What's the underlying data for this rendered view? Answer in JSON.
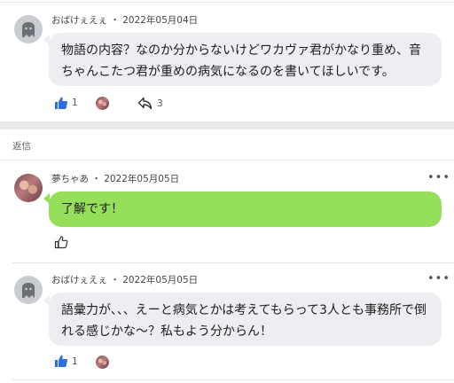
{
  "comments": [
    {
      "author": "おばけぇえぇ",
      "separator": "・",
      "date": "2022年05月04日",
      "text": "物語の内容？なのか分からないけどワカヴァ君がかなり重め、音ちゃんこたつ君が重めの病気になるのを書いてほしいです。",
      "like_count": "1",
      "reply_count": "3"
    },
    {
      "author": "夢ちゃあ",
      "separator": "・",
      "date": "2022年05月05日",
      "text": "了解です！",
      "more": "•••"
    },
    {
      "author": "おばけぇえぇ",
      "separator": "・",
      "date": "2022年05月05日",
      "text": "語彙力が、、、えーと病気とかは考えてもらって3人とも事務所で倒れる感じかな〜？私もよう分からん！",
      "like_count": "1",
      "more": "•••"
    }
  ],
  "replies_label": "返信",
  "colors": {
    "accent_blue": "#2f6fdc",
    "bubble_gray": "#eceef1",
    "bubble_green": "#96df5a"
  }
}
